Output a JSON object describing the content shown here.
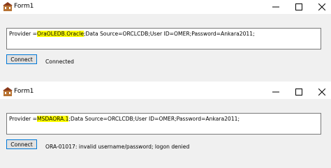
{
  "windows": [
    {
      "title": "Form1",
      "connection": {
        "prefix": "Provider =",
        "highlight": "OraOLEDB.Oracle",
        "rest": ";Data Source=ORCLCDB;User ID=OMER;Password=Ankara2011;"
      },
      "connect_label": "Connect",
      "status": "Connected"
    },
    {
      "title": "Form1",
      "connection": {
        "prefix": "Provider =",
        "highlight": "MSDAORA.1",
        "rest": ";Data Source=ORCLCDB;User ID=OMER;Password=Ankara2011;"
      },
      "connect_label": "Connect",
      "status": "ORA-01017: invalid username/password; logon denied"
    }
  ],
  "colors": {
    "highlight": "#ffff00",
    "button_border": "#0078d7"
  },
  "icons": [
    "app-icon",
    "minimize-icon",
    "maximize-icon",
    "close-icon"
  ]
}
